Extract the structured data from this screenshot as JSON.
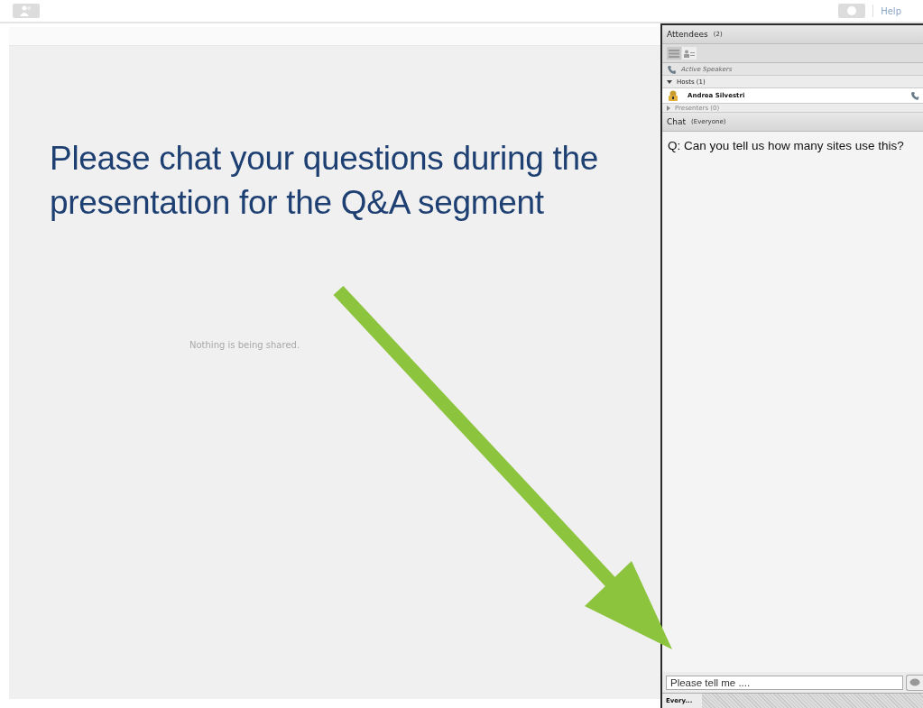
{
  "top_bar": {
    "help": "Help"
  },
  "share_pod": {
    "status": "Nothing is being shared.",
    "overlay_message": "Please chat your questions during the presentation for the Q&A segment"
  },
  "attendees": {
    "title": "Attendees",
    "count": "(2)",
    "views": [
      {
        "kind": "list",
        "selected": true
      },
      {
        "kind": "person",
        "selected": false
      }
    ],
    "active_speakers": "Active Speakers",
    "groups": [
      {
        "label": "Hosts (1)",
        "expanded": true,
        "members": [
          {
            "name": "Andrea Silvestri"
          }
        ]
      },
      {
        "label": "Presenters (0)",
        "expanded": false
      }
    ]
  },
  "chat": {
    "title": "Chat",
    "scope": "(Everyone)",
    "messages": [
      "Q: Can you tell us how many sites use this?"
    ],
    "input_value": "Please tell me ....",
    "tab": "Every..."
  }
}
